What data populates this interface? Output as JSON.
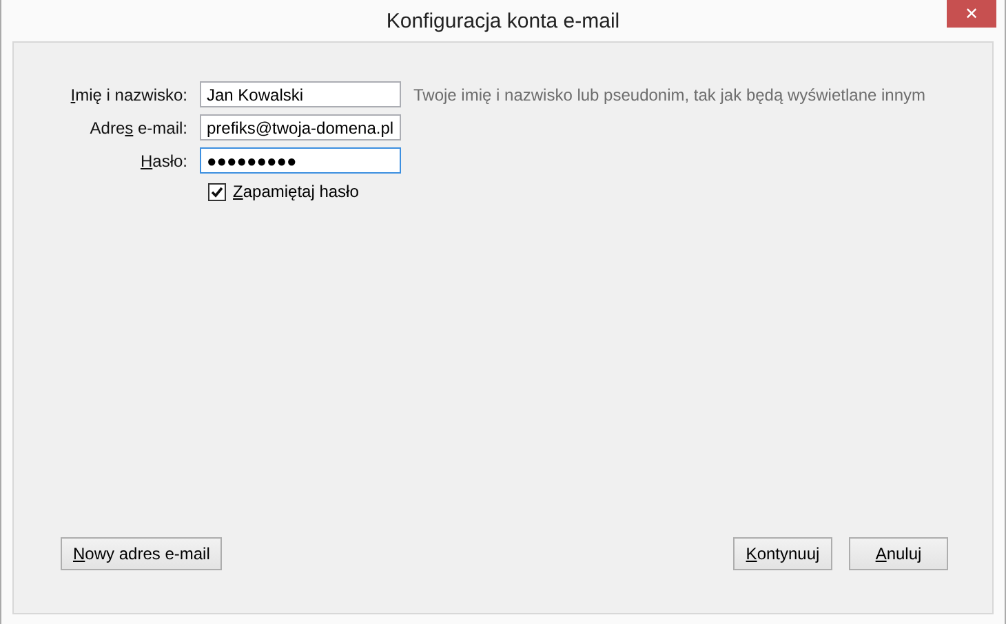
{
  "window": {
    "title": "Konfiguracja konta e-mail",
    "close": "✕"
  },
  "fields": [
    {
      "label": {
        "key": "I",
        "after": "mię i nazwisko:"
      },
      "value": "Jan Kowalski",
      "focused": false,
      "hint": "Twoje imię i nazwisko lub pseudonim, tak jak będą wyświetlane innym"
    },
    {
      "label": {
        "before": "Adre",
        "key": "s",
        "after": " e-mail:"
      },
      "value": "prefiks@twoja-domena.pl",
      "focused": false
    },
    {
      "label": {
        "key": "H",
        "after": "asło:"
      },
      "value": "●●●●●●●●●",
      "focused": true
    }
  ],
  "remember": {
    "label": {
      "key": "Z",
      "after": "apamiętaj hasło"
    },
    "checked": true
  },
  "left_buttons": [
    {
      "label": {
        "key": "N",
        "after": "owy adres e-mail"
      }
    }
  ],
  "right_buttons": [
    {
      "label": {
        "key": "K",
        "after": "ontynuuj"
      }
    },
    {
      "label": {
        "key": "A",
        "after": "nuluj"
      }
    }
  ]
}
